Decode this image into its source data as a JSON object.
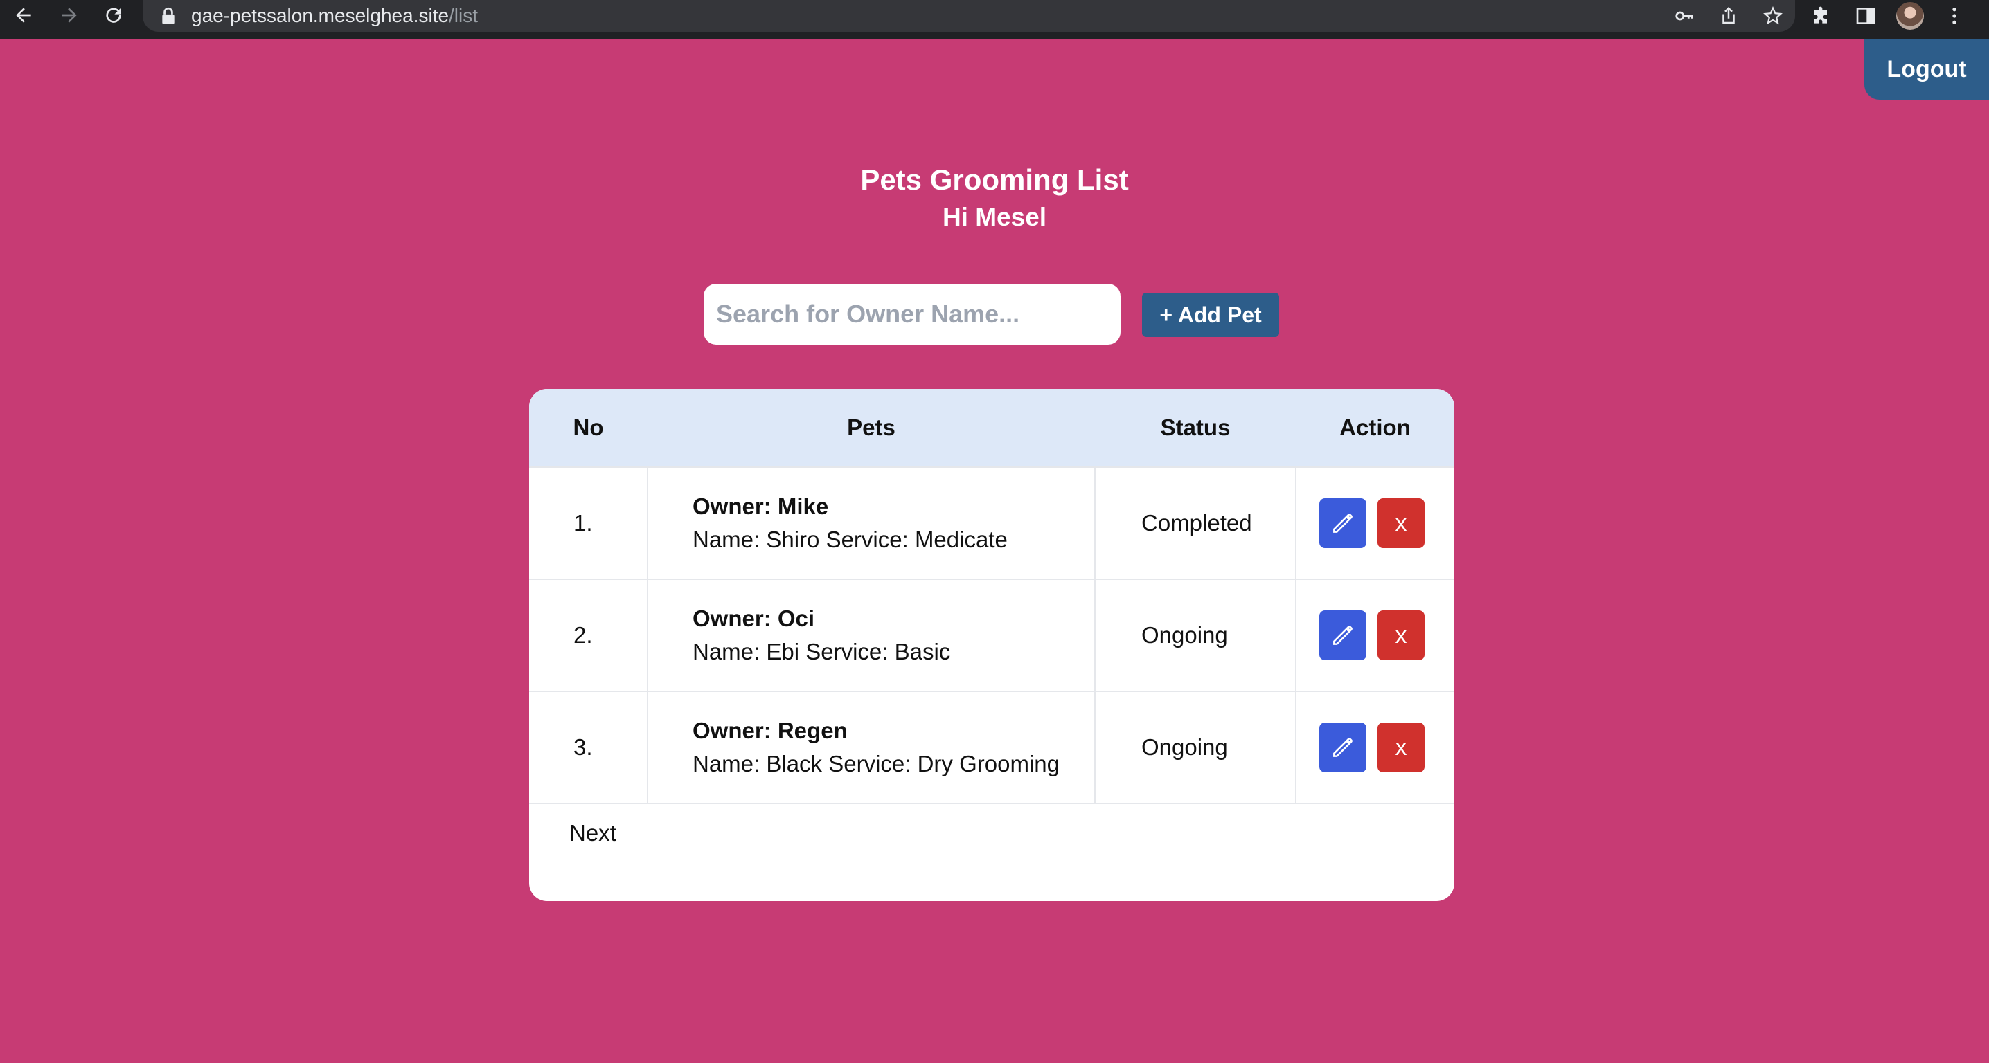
{
  "browser": {
    "url_host": "gae-petssalon.meselghea.site",
    "url_path": "/list",
    "nav_icons": [
      "back-icon",
      "forward-icon",
      "reload-icon"
    ],
    "omnibox_icons": [
      "key-icon",
      "share-icon",
      "star-icon"
    ],
    "toolbar_icons": [
      "extensions-icon",
      "side-panel-icon",
      "avatar",
      "menu-icon"
    ]
  },
  "header": {
    "logout_label": "Logout",
    "title": "Pets Grooming List",
    "greeting": "Hi Mesel"
  },
  "search": {
    "placeholder": "Search for Owner Name...",
    "value": ""
  },
  "add_button_label": "+ Add Pet",
  "table": {
    "columns": [
      "No",
      "Pets",
      "Status",
      "Action"
    ],
    "rows": [
      {
        "no": "1.",
        "owner": "Owner: Mike",
        "details": "Name: Shiro Service: Medicate",
        "status": "Completed"
      },
      {
        "no": "2.",
        "owner": "Owner: Oci",
        "details": "Name: Ebi Service: Basic",
        "status": "Ongoing"
      },
      {
        "no": "3.",
        "owner": "Owner: Regen",
        "details": "Name: Black Service: Dry Grooming",
        "status": "Ongoing"
      }
    ],
    "edit_icon": "pencil-icon",
    "delete_label": "x",
    "next_label": "Next"
  },
  "colors": {
    "page_background": "#c73b74",
    "primary_button": "#2d5d8a",
    "table_header": "#dde8f8",
    "edit_button": "#3b5bdb",
    "delete_button": "#d0312d"
  }
}
